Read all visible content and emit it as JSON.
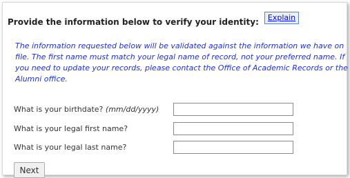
{
  "header": {
    "title": "Provide the information below to verify your identity:",
    "explain_label": "Explain"
  },
  "notice": "The information requested below will be validated against the information we have on file. The first name must match your legal name of record, not your preferred name. If you need to update your records, please contact the Office of Academic Records or the Alumni office.",
  "form": {
    "birthdate_label": "What is your birthdate?",
    "birthdate_hint": "(mm/dd/yyyy)",
    "birthdate_value": "",
    "first_name_label": "What is your legal first name?",
    "first_name_value": "",
    "last_name_label": "What is your legal last name?",
    "last_name_value": "",
    "next_label": "Next"
  }
}
